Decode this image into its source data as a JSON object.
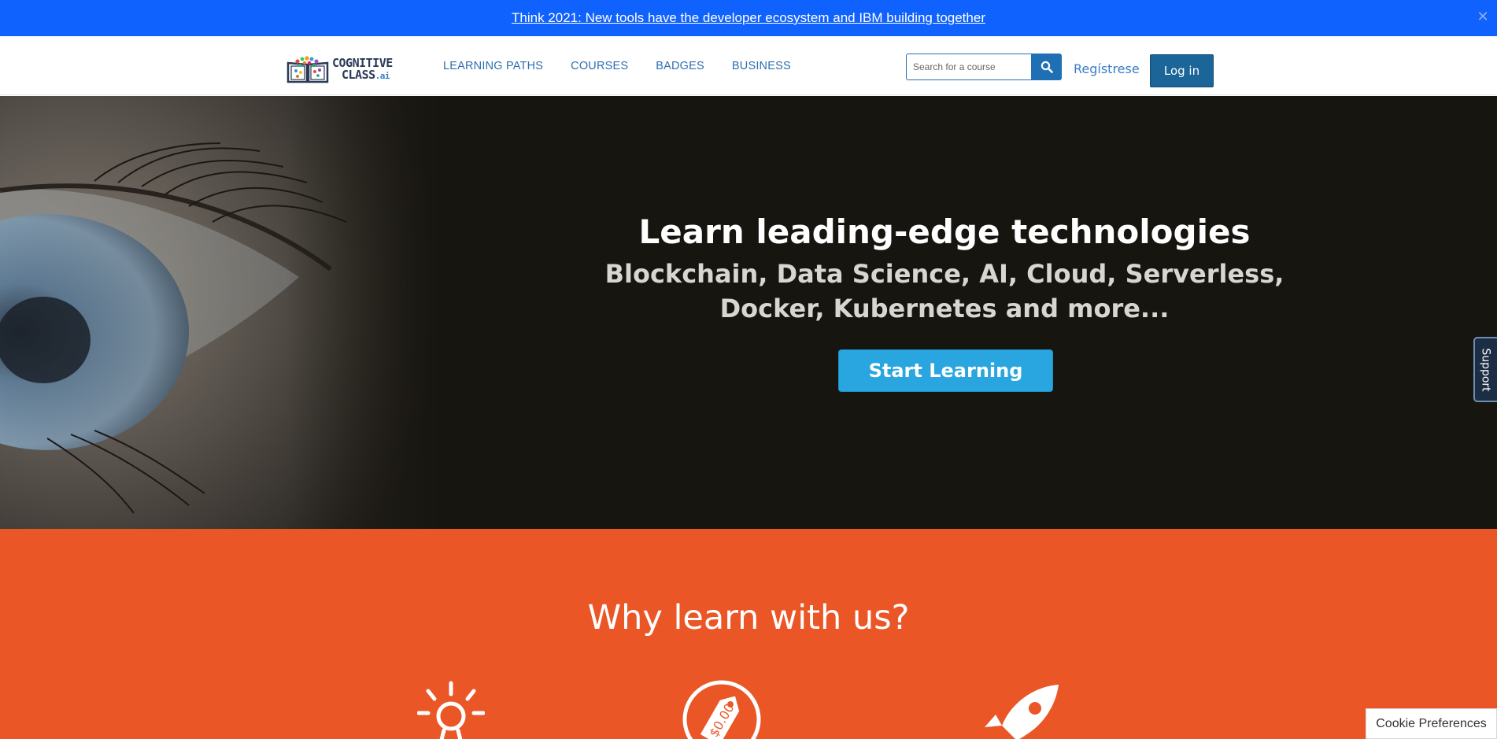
{
  "announcement": {
    "text": "Think 2021: New tools have the developer ecosystem and IBM building together",
    "close_icon": "close-icon"
  },
  "header": {
    "logo": {
      "line1": "COGNITIVE",
      "line2": "CLASS",
      "suffix": ".ai"
    },
    "nav": [
      {
        "label": "LEARNING PATHS"
      },
      {
        "label": "COURSES"
      },
      {
        "label": "BADGES"
      },
      {
        "label": "BUSINESS"
      }
    ],
    "search": {
      "placeholder": "Search for a course",
      "value": "",
      "icon": "search-icon"
    },
    "register_label": "Regístrese",
    "login_label": "Log in"
  },
  "hero": {
    "title": "Learn leading-edge technologies",
    "subtitle_line1": "Blockchain, Data Science, AI, Cloud, Serverless,",
    "subtitle_line2": "Docker, Kubernetes and more...",
    "cta_label": "Start Learning"
  },
  "support_tab": {
    "label": "Support"
  },
  "why": {
    "title": "Why learn with us?",
    "icons": [
      "lightbulb-icon",
      "price-tag-icon",
      "rocket-icon"
    ],
    "price_tag_text": "$0.00"
  },
  "cookie_label": "Cookie Preferences",
  "colors": {
    "announce_bg": "#0f62fe",
    "hero_bg": "#17150f",
    "cta_bg": "#29a6df",
    "why_bg": "#eb5627",
    "nav_link": "#2c6fb0",
    "login_bg": "#1b6598"
  }
}
